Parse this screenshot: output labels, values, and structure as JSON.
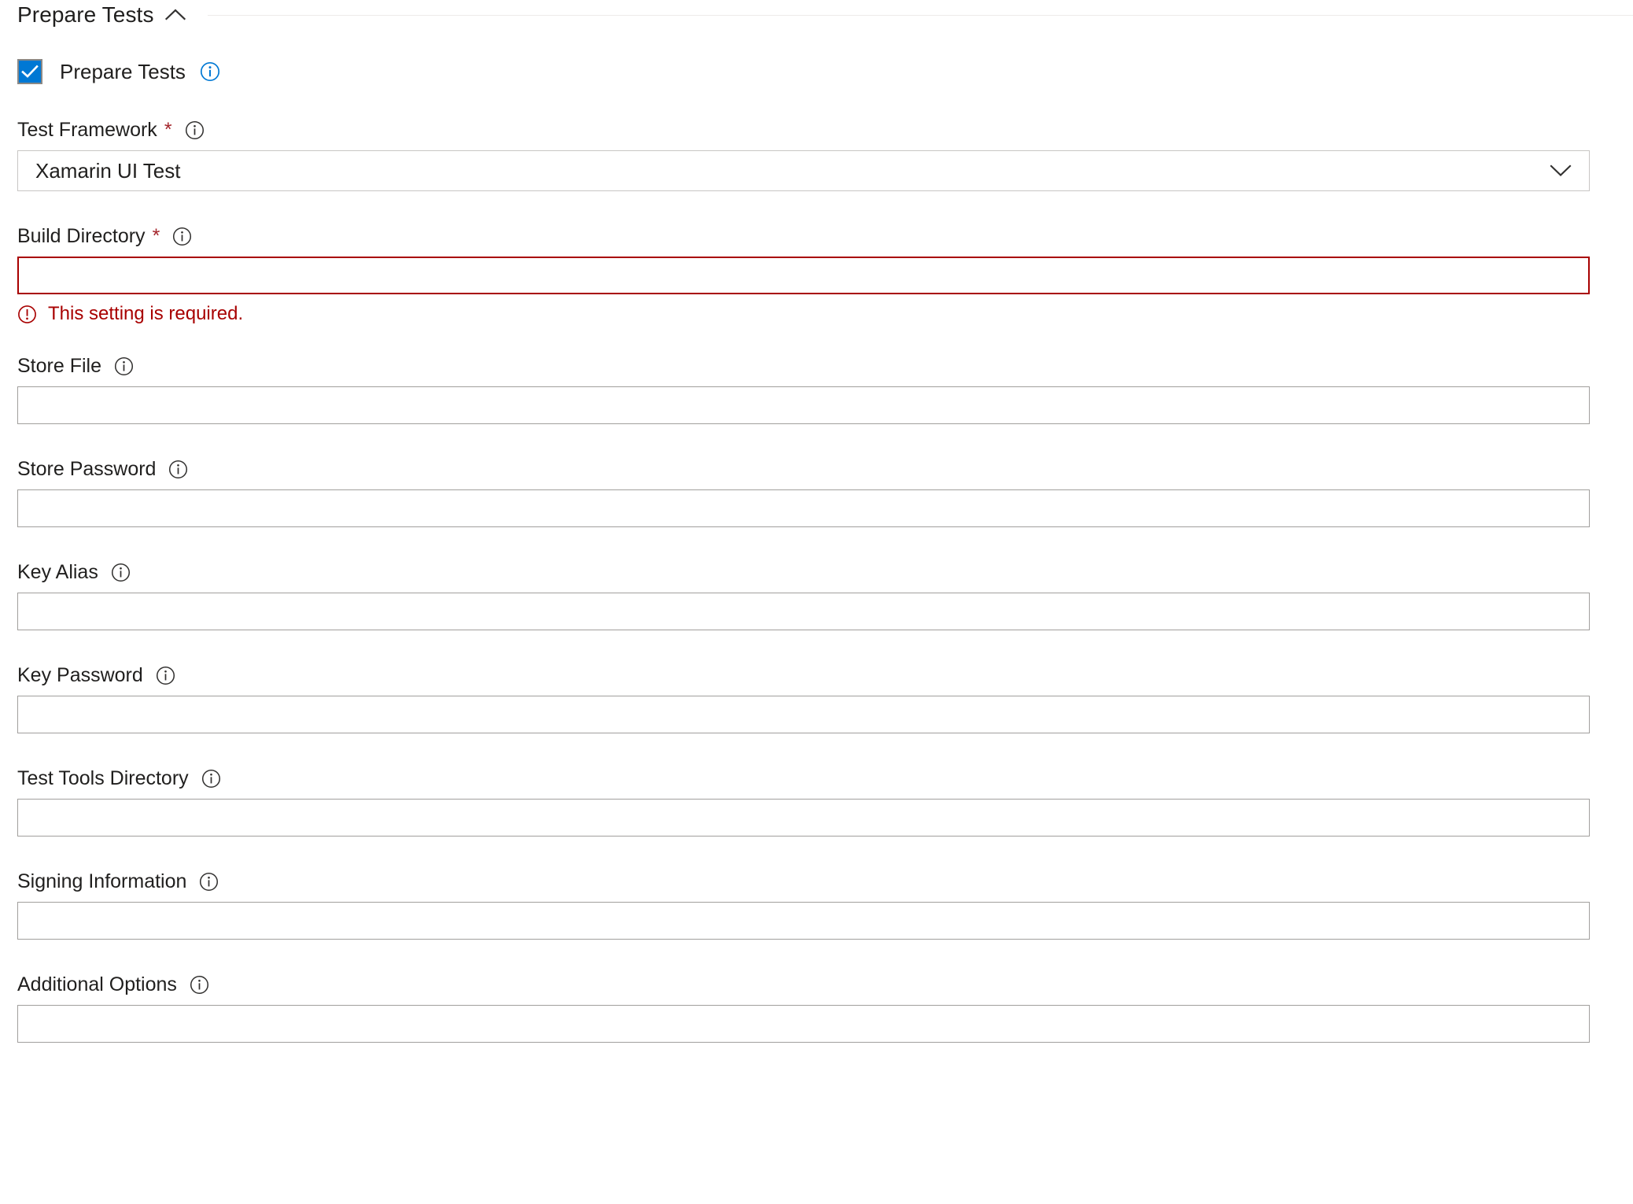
{
  "section": {
    "title": "Prepare Tests",
    "collapse_icon": "chevron-up-icon",
    "expanded": true
  },
  "enable_checkbox": {
    "label": "Prepare Tests",
    "checked": true,
    "info_icon": "info-icon",
    "info_icon_color": "#0078d4",
    "checkbox_color": "#0078d4"
  },
  "fields": [
    {
      "name": "test-framework",
      "label": "Test Framework",
      "required": true,
      "type": "select",
      "value": "Xamarin UI Test",
      "info_icon": "info-icon",
      "chevron_icon": "chevron-down-icon"
    },
    {
      "name": "build-directory",
      "label": "Build Directory",
      "required": true,
      "type": "text",
      "value": "",
      "info_icon": "info-icon",
      "error": {
        "icon": "error-circle-icon",
        "message": "This setting is required.",
        "color": "#a80000"
      }
    },
    {
      "name": "store-file",
      "label": "Store File",
      "required": false,
      "type": "text",
      "value": "",
      "info_icon": "info-icon"
    },
    {
      "name": "store-password",
      "label": "Store Password",
      "required": false,
      "type": "text",
      "value": "",
      "info_icon": "info-icon"
    },
    {
      "name": "key-alias",
      "label": "Key Alias",
      "required": false,
      "type": "text",
      "value": "",
      "info_icon": "info-icon"
    },
    {
      "name": "key-password",
      "label": "Key Password",
      "required": false,
      "type": "text",
      "value": "",
      "info_icon": "info-icon"
    },
    {
      "name": "test-tools-directory",
      "label": "Test Tools Directory",
      "required": false,
      "type": "text",
      "value": "",
      "info_icon": "info-icon"
    },
    {
      "name": "signing-information",
      "label": "Signing Information",
      "required": false,
      "type": "text",
      "value": "",
      "info_icon": "info-icon"
    },
    {
      "name": "additional-options",
      "label": "Additional Options",
      "required": false,
      "type": "text",
      "value": "",
      "info_icon": "info-icon"
    }
  ],
  "colors": {
    "accent": "#0078d4",
    "error": "#a80000",
    "required_star": "#a4262c",
    "border": "#a19f9d",
    "text": "#201f1e"
  }
}
